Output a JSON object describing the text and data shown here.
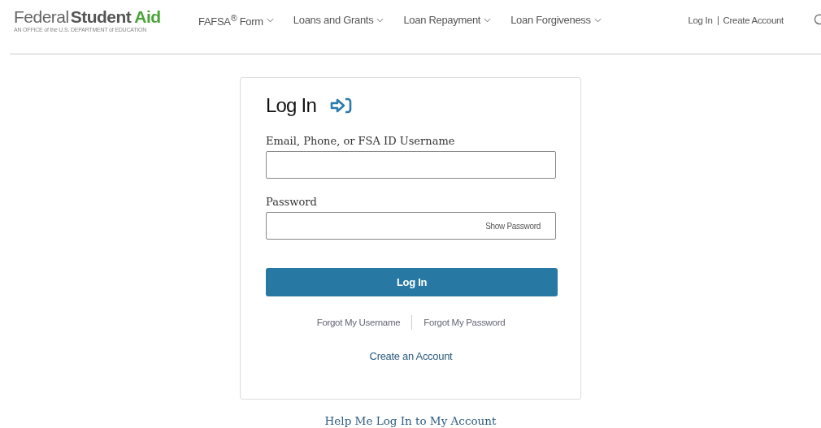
{
  "logo": {
    "light": "Federal",
    "bold": "Student",
    "accent": "Aid",
    "tagline": "AN OFFICE of the U.S. DEPARTMENT of EDUCATION"
  },
  "nav": [
    {
      "label": "FAFSA$^{®}$ Form"
    },
    {
      "label": "Loans and Grants"
    },
    {
      "label": "Loan Repayment"
    },
    {
      "label": "Loan Forgiveness"
    }
  ],
  "account_links": [
    "Log In",
    "Create Account"
  ],
  "login": {
    "title": "Log In",
    "fields": [
      {
        "label": "Email, Phone, or FSA ID Username"
      },
      {
        "label": "Password",
        "toggle": "Show Password"
      }
    ],
    "submit": "Log In",
    "forgot_links": [
      "Forgot My Username",
      "Forgot My Password"
    ],
    "create_link": "Create an Account"
  },
  "help_link": "Help Me Log In to My Account"
}
